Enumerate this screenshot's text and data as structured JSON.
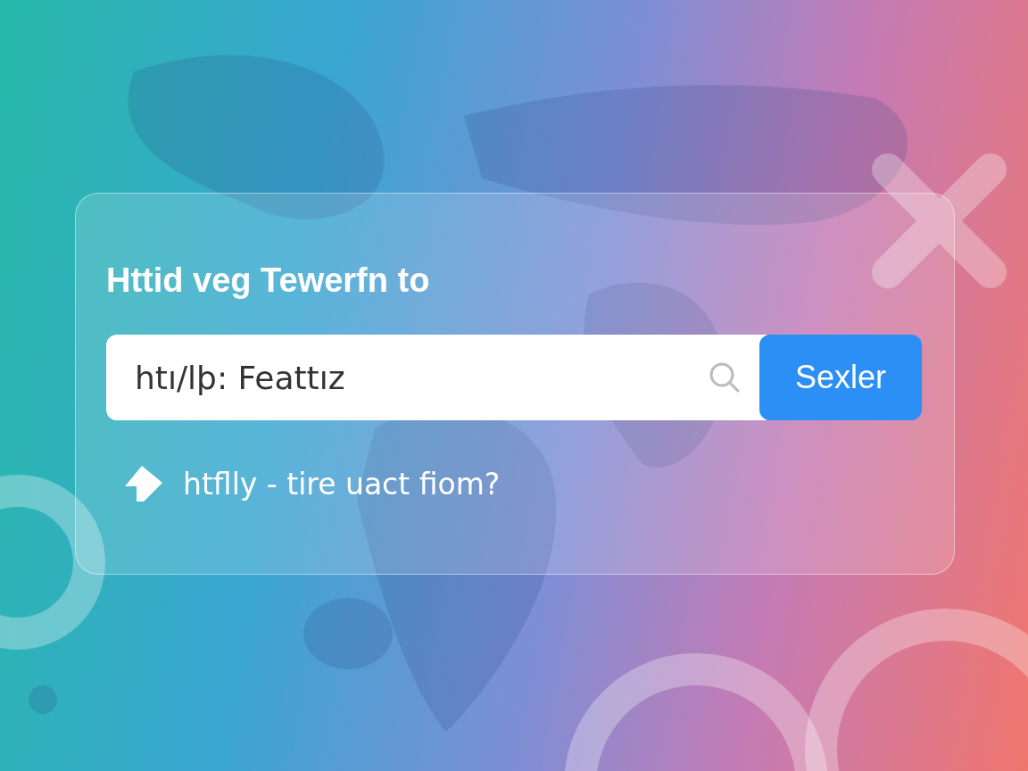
{
  "card": {
    "title": "Httid veg Tewerfn to",
    "search": {
      "value": "htı/lþ: Feattız",
      "button": "Sexler"
    },
    "hint": {
      "text": "htflly - tire uact fiom?"
    }
  }
}
